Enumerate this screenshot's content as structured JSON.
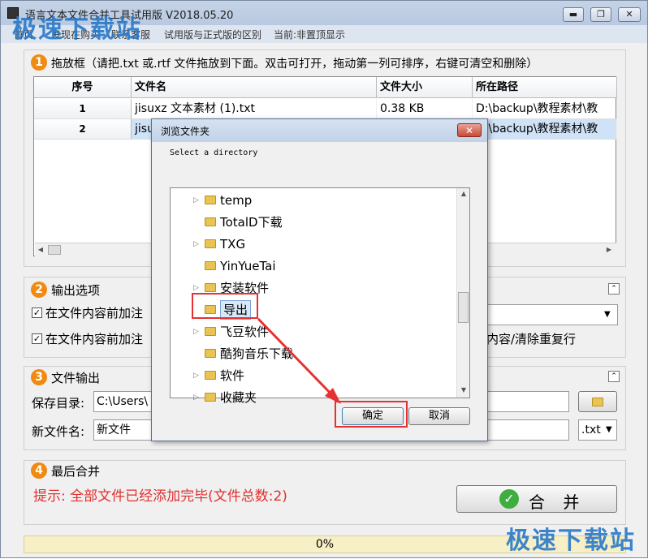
{
  "window": {
    "title": "语言文本文件合并工具试用版 V2018.05.20",
    "minimize": "▬",
    "restore": "❐",
    "close": "✕"
  },
  "menu": [
    "首页",
    "发现在购买",
    "联系客服",
    "试用版与正式版的区别",
    "当前:非置顶显示"
  ],
  "watermark": "极速下载站",
  "section1": {
    "number": "1",
    "title": "拖放框（请把.txt 或.rtf 文件拖放到下面。双击可打开，拖动第一列可排序，右键可清空和删除）",
    "columns": [
      "序号",
      "文件名",
      "文件大小",
      "所在路径"
    ],
    "rows": [
      {
        "index": "1",
        "name": "jisuxz 文本素材 (1).txt",
        "size": "0.38 KB",
        "path": "D:\\backup\\教程素材\\教"
      },
      {
        "index": "2",
        "name": "jisu",
        "size": "",
        "path": "D:\\backup\\教程素材\\教"
      }
    ]
  },
  "section2": {
    "number": "2",
    "title": "输出选项",
    "option1": "在文件内容前加注",
    "option2": "在文件内容前加注",
    "option2_tail": "内容/清除重复行"
  },
  "section3": {
    "number": "3",
    "title": "文件输出",
    "save_dir_label": "保存目录:",
    "save_dir_value": "C:\\Users\\",
    "new_name_label": "新文件名:",
    "new_name_value": "新文件",
    "ext": ".txt"
  },
  "section4": {
    "number": "4",
    "title": "最后合并",
    "hint": "提示: 全部文件已经添加完毕(文件总数:2)",
    "merge_label": "合 并",
    "merge_check": "✓"
  },
  "progress": "0%",
  "dialog": {
    "title": "浏览文件夹",
    "prompt": "Select a directory",
    "close": "✕",
    "folders": [
      {
        "name": "temp",
        "expandable": true
      },
      {
        "name": "TotalD下载",
        "expandable": false
      },
      {
        "name": "TXG",
        "expandable": true
      },
      {
        "name": "YinYueTai",
        "expandable": false
      },
      {
        "name": "安装软件",
        "expandable": true
      },
      {
        "name": "导出",
        "expandable": false,
        "selected": true
      },
      {
        "name": "飞豆软件",
        "expandable": true
      },
      {
        "name": "酷狗音乐下载",
        "expandable": false
      },
      {
        "name": "软件",
        "expandable": true
      },
      {
        "name": "收藏夹",
        "expandable": true
      }
    ],
    "ok": "确定",
    "cancel": "取消"
  },
  "colors": {
    "accent": "#f08a12",
    "hint": "#e03030",
    "highlight": "#e53131",
    "selection": "#cfe2f7"
  }
}
